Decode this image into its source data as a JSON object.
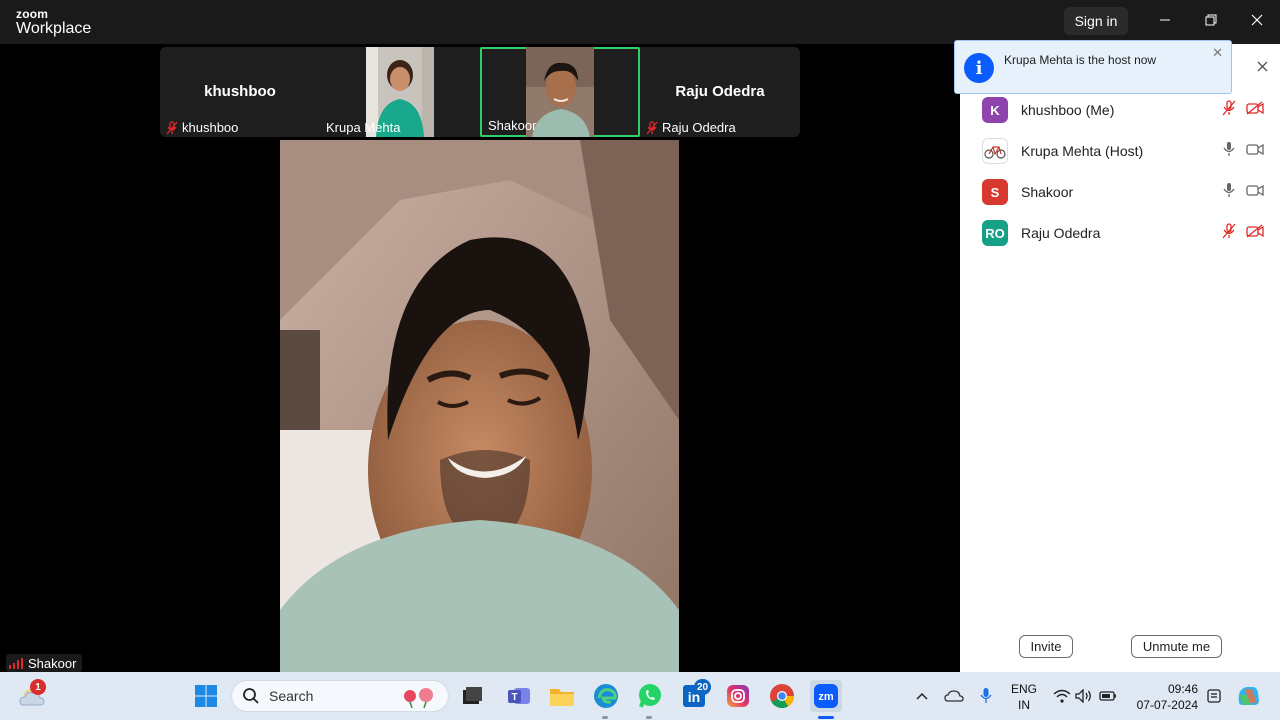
{
  "titlebar": {
    "logo_line1": "zoom",
    "logo_line2": "Workplace",
    "sign_in": "Sign in"
  },
  "gallery": {
    "tiles": [
      {
        "name": "khushboo",
        "display_name": "khushboo",
        "muted": true,
        "video": false
      },
      {
        "name": "Krupa Mehta",
        "video": true
      },
      {
        "name": "Shakoor",
        "video": true,
        "active_speaker": true
      },
      {
        "name": "Raju Odedra",
        "display_name": "Raju Odedra",
        "muted": true,
        "video": false
      }
    ]
  },
  "main_video": {
    "speaker_name": "Shakoor"
  },
  "notification": {
    "message": "Krupa Mehta is the host now"
  },
  "participants": [
    {
      "initials": "K",
      "name": "khushboo (Me)",
      "avatar_color": "#8e44ad",
      "mic": "muted",
      "video": "off"
    },
    {
      "initials": "",
      "name": "Krupa Mehta (Host)",
      "avatar_color": "#ffffff",
      "mic": "on",
      "video": "on-idle"
    },
    {
      "initials": "S",
      "name": "Shakoor",
      "avatar_color": "#d63a2f",
      "mic": "on",
      "video": "on-idle"
    },
    {
      "initials": "RO",
      "name": "Raju Odedra",
      "avatar_color": "#16a085",
      "mic": "muted",
      "video": "off"
    }
  ],
  "panel_buttons": {
    "invite": "Invite",
    "unmute": "Unmute me"
  },
  "taskbar": {
    "weather_badge": "1",
    "search_placeholder": "Search",
    "linkedin_badge": "20",
    "lang_line1": "ENG",
    "lang_line2": "IN",
    "time": "09:46",
    "date": "07-07-2024"
  },
  "colors": {
    "active_border": "#2fd06b",
    "mute_red": "#e02828",
    "zoom_blue": "#0b5cff"
  }
}
